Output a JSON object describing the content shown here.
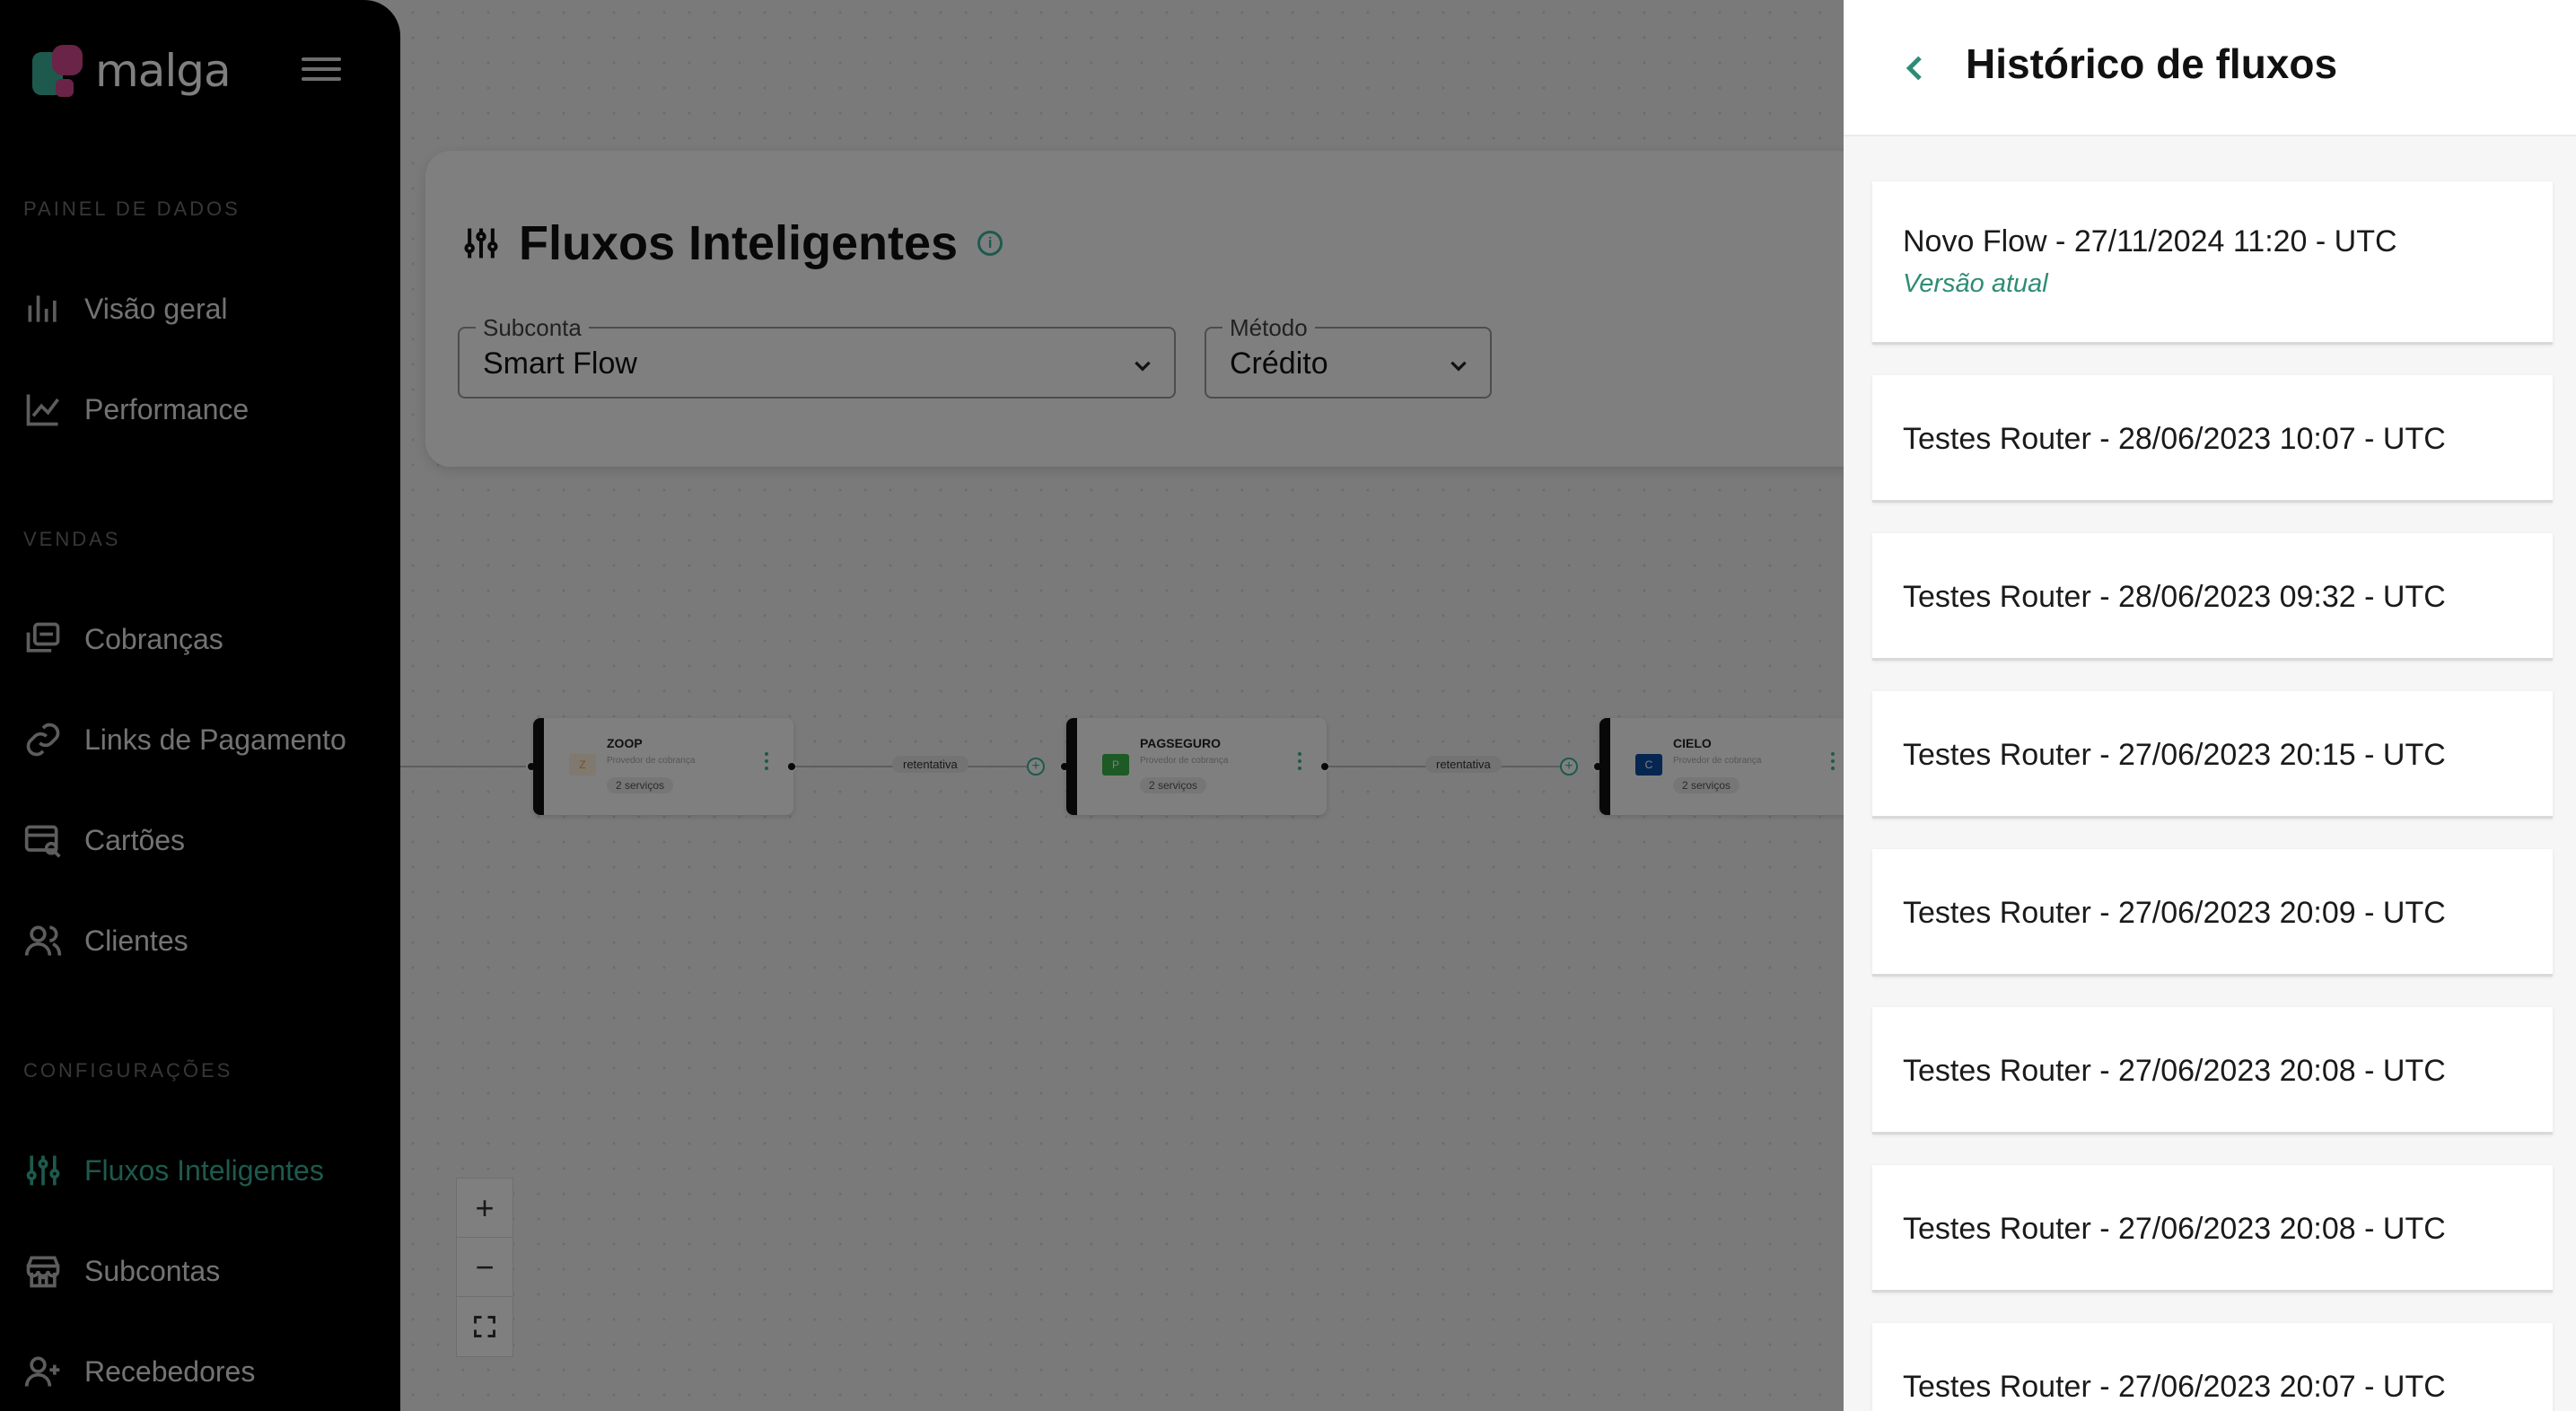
{
  "brand": {
    "name": "malga"
  },
  "sidebar": {
    "sections": [
      {
        "label": "PAINEL DE DADOS",
        "items": [
          {
            "label": "Visão geral",
            "icon": "bar-chart-icon"
          },
          {
            "label": "Performance",
            "icon": "line-chart-icon"
          }
        ]
      },
      {
        "label": "VENDAS",
        "items": [
          {
            "label": "Cobranças",
            "icon": "charges-icon"
          },
          {
            "label": "Links de Pagamento",
            "icon": "link-icon"
          },
          {
            "label": "Cartões",
            "icon": "card-search-icon"
          },
          {
            "label": "Clientes",
            "icon": "users-icon"
          }
        ]
      },
      {
        "label": "CONFIGURAÇÕES",
        "items": [
          {
            "label": "Fluxos Inteligentes",
            "icon": "sliders-icon",
            "active": true
          },
          {
            "label": "Subcontas",
            "icon": "store-icon"
          },
          {
            "label": "Recebedores",
            "icon": "user-plus-icon"
          }
        ]
      }
    ]
  },
  "main": {
    "title": "Fluxos Inteligentes",
    "subconta": {
      "label": "Subconta",
      "value": "Smart Flow"
    },
    "metodo": {
      "label": "Método",
      "value": "Crédito"
    }
  },
  "flow": {
    "nodes": [
      {
        "name": "ZOOP",
        "desc": "Provedor de cobrança",
        "chip": "2 serviços",
        "logo_color": "#f5a623"
      },
      {
        "name": "PAGSEGURO",
        "desc": "Provedor de cobrança",
        "chip": "2 serviços",
        "logo_color": "#3bb54a"
      },
      {
        "name": "CIELO",
        "desc": "Provedor de cobrança",
        "chip": "2 serviços",
        "logo_color": "#0a4da2"
      }
    ],
    "edge_label": "retentativa"
  },
  "zoom": {
    "in": "+",
    "out": "−"
  },
  "drawer": {
    "title": "Histórico de fluxos",
    "current_label": "Versão atual",
    "items": [
      "Novo Flow - 27/11/2024 11:20 - UTC",
      "Testes Router - 28/06/2023 10:07 - UTC",
      "Testes Router - 28/06/2023 09:32 - UTC",
      "Testes Router - 27/06/2023 20:15 - UTC",
      "Testes Router - 27/06/2023 20:09 - UTC",
      "Testes Router - 27/06/2023 20:08 - UTC",
      "Testes Router - 27/06/2023 20:08 - UTC",
      "Testes Router - 27/06/2023 20:07 - UTC"
    ]
  },
  "colors": {
    "accent": "#3bb59a",
    "brand_pink": "#d2488e"
  }
}
